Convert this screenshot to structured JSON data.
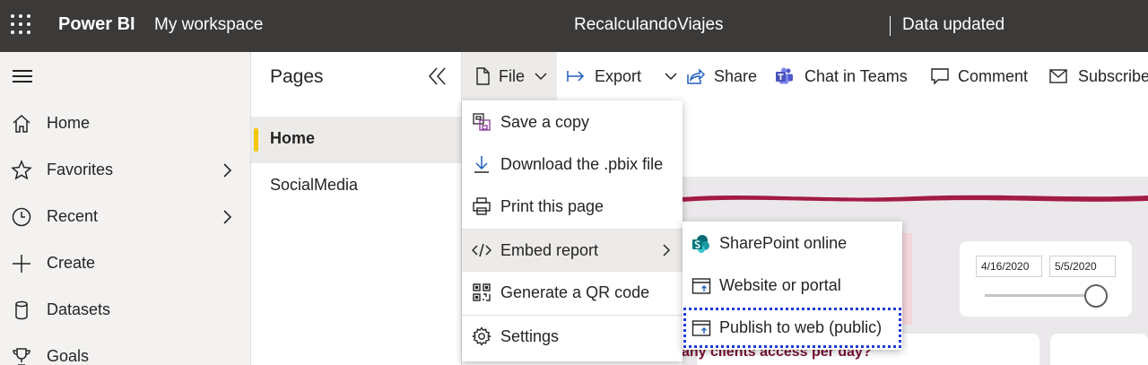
{
  "header": {
    "app_name": "Power BI",
    "workspace": "My workspace",
    "report_name": "RecalculandoViajes",
    "status": "Data updated"
  },
  "nav": {
    "items": [
      {
        "label": "Home",
        "icon": "home-icon",
        "has_submenu": false
      },
      {
        "label": "Favorites",
        "icon": "star-icon",
        "has_submenu": true
      },
      {
        "label": "Recent",
        "icon": "clock-icon",
        "has_submenu": true
      },
      {
        "label": "Create",
        "icon": "plus-icon",
        "has_submenu": false
      },
      {
        "label": "Datasets",
        "icon": "database-icon",
        "has_submenu": false
      },
      {
        "label": "Goals",
        "icon": "trophy-icon",
        "has_submenu": false
      }
    ]
  },
  "pages": {
    "title": "Pages",
    "items": [
      {
        "label": "Home",
        "active": true
      },
      {
        "label": "SocialMedia",
        "active": false
      }
    ]
  },
  "toolbar": {
    "file": "File",
    "export": "Export",
    "share": "Share",
    "chat": "Chat in Teams",
    "comment": "Comment",
    "subscribe": "Subscribe"
  },
  "file_menu": {
    "items": [
      {
        "label": "Save a copy",
        "icon": "save-copy-icon"
      },
      {
        "label": "Download the .pbix file",
        "icon": "download-icon"
      },
      {
        "label": "Print this page",
        "icon": "print-icon"
      },
      {
        "label": "Embed report",
        "icon": "code-icon",
        "has_submenu": true
      },
      {
        "label": "Generate a QR code",
        "icon": "qr-code-icon"
      },
      {
        "label": "Settings",
        "icon": "gear-icon"
      }
    ]
  },
  "embed_menu": {
    "items": [
      {
        "label": "SharePoint online",
        "icon": "sharepoint-icon"
      },
      {
        "label": "Website or portal",
        "icon": "website-icon"
      },
      {
        "label": "Publish to web (public)",
        "icon": "publish-web-icon",
        "highlighted": true
      }
    ]
  },
  "report": {
    "date_start": "4/16/2020",
    "date_end": "5/5/2020",
    "visual_title": "any clients access per day?"
  },
  "colors": {
    "header_bg": "#3b3a39",
    "accent_yellow": "#f2c811",
    "highlight_blue": "#1f3ad8",
    "report_red": "#a31b45"
  }
}
